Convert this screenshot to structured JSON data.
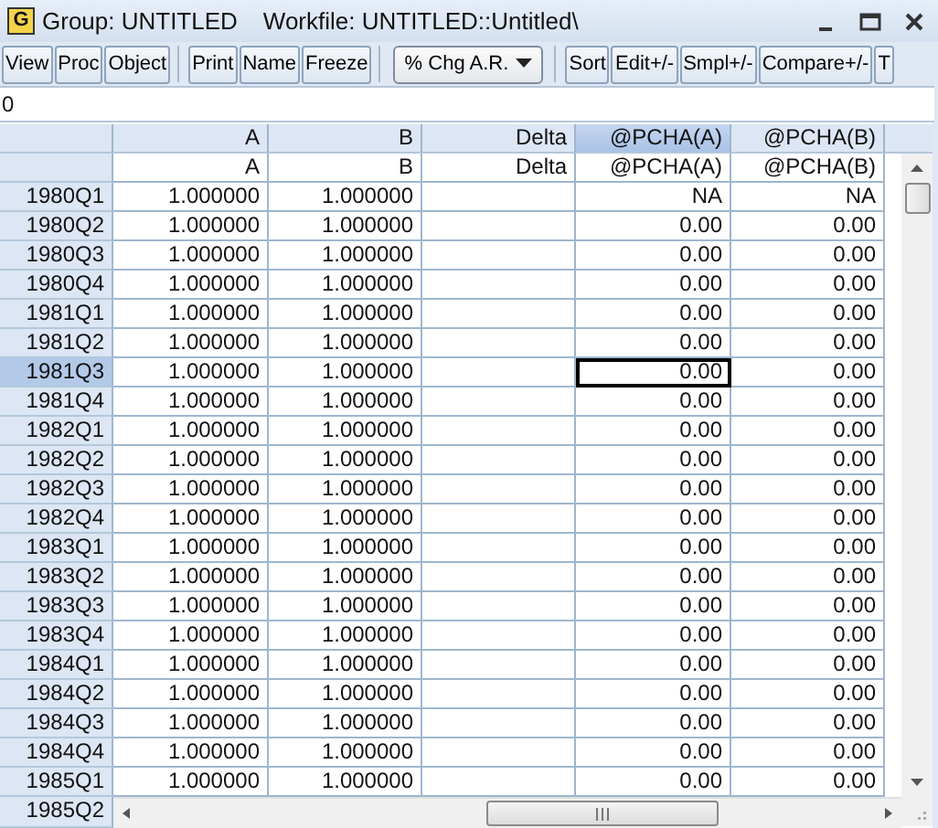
{
  "window": {
    "icon_letter": "G",
    "title": "Group: UNTITLED",
    "workfile": "Workfile: UNTITLED::Untitled\\"
  },
  "toolbar": [
    {
      "kind": "button",
      "label": "View"
    },
    {
      "kind": "button",
      "label": "Proc"
    },
    {
      "kind": "button",
      "label": "Object"
    },
    {
      "kind": "separator"
    },
    {
      "kind": "button",
      "label": "Print"
    },
    {
      "kind": "button",
      "label": "Name"
    },
    {
      "kind": "button",
      "label": "Freeze"
    },
    {
      "kind": "separator"
    },
    {
      "kind": "dropdown",
      "label": "% Chg A.R."
    },
    {
      "kind": "separator"
    },
    {
      "kind": "button",
      "label": "Sort"
    },
    {
      "kind": "button",
      "label": "Edit+/-"
    },
    {
      "kind": "button",
      "label": "Smpl+/-"
    },
    {
      "kind": "button",
      "label": "Compare+/-"
    },
    {
      "kind": "button",
      "label": "T"
    }
  ],
  "edit_line": "0",
  "columns": [
    {
      "header": "A",
      "name": "A",
      "selected": false
    },
    {
      "header": "B",
      "name": "B",
      "selected": false
    },
    {
      "header": "Delta",
      "name": "Delta",
      "selected": false
    },
    {
      "header": "@PCHA(A)",
      "name": "@PCHA(A)",
      "selected": true
    },
    {
      "header": "@PCHA(B)",
      "name": "@PCHA(B)",
      "selected": false
    }
  ],
  "rows": [
    {
      "label": "1980Q1",
      "selected": false,
      "cells": [
        {
          "text": "1.000000",
          "selected": false
        },
        {
          "text": "1.000000",
          "selected": false
        },
        {
          "text": "",
          "selected": false
        },
        {
          "text": "NA",
          "selected": false
        },
        {
          "text": "NA",
          "selected": false
        }
      ]
    },
    {
      "label": "1980Q2",
      "selected": false,
      "cells": [
        {
          "text": "1.000000",
          "selected": false
        },
        {
          "text": "1.000000",
          "selected": false
        },
        {
          "text": "",
          "selected": false
        },
        {
          "text": "0.00",
          "selected": false
        },
        {
          "text": "0.00",
          "selected": false
        }
      ]
    },
    {
      "label": "1980Q3",
      "selected": false,
      "cells": [
        {
          "text": "1.000000",
          "selected": false
        },
        {
          "text": "1.000000",
          "selected": false
        },
        {
          "text": "",
          "selected": false
        },
        {
          "text": "0.00",
          "selected": false
        },
        {
          "text": "0.00",
          "selected": false
        }
      ]
    },
    {
      "label": "1980Q4",
      "selected": false,
      "cells": [
        {
          "text": "1.000000",
          "selected": false
        },
        {
          "text": "1.000000",
          "selected": false
        },
        {
          "text": "",
          "selected": false
        },
        {
          "text": "0.00",
          "selected": false
        },
        {
          "text": "0.00",
          "selected": false
        }
      ]
    },
    {
      "label": "1981Q1",
      "selected": false,
      "cells": [
        {
          "text": "1.000000",
          "selected": false
        },
        {
          "text": "1.000000",
          "selected": false
        },
        {
          "text": "",
          "selected": false
        },
        {
          "text": "0.00",
          "selected": false
        },
        {
          "text": "0.00",
          "selected": false
        }
      ]
    },
    {
      "label": "1981Q2",
      "selected": false,
      "cells": [
        {
          "text": "1.000000",
          "selected": false
        },
        {
          "text": "1.000000",
          "selected": false
        },
        {
          "text": "",
          "selected": false
        },
        {
          "text": "0.00",
          "selected": false
        },
        {
          "text": "0.00",
          "selected": false
        }
      ]
    },
    {
      "label": "1981Q3",
      "selected": true,
      "cells": [
        {
          "text": "1.000000",
          "selected": false
        },
        {
          "text": "1.000000",
          "selected": false
        },
        {
          "text": "",
          "selected": false
        },
        {
          "text": "0.00",
          "selected": true
        },
        {
          "text": "0.00",
          "selected": false
        }
      ]
    },
    {
      "label": "1981Q4",
      "selected": false,
      "cells": [
        {
          "text": "1.000000",
          "selected": false
        },
        {
          "text": "1.000000",
          "selected": false
        },
        {
          "text": "",
          "selected": false
        },
        {
          "text": "0.00",
          "selected": false
        },
        {
          "text": "0.00",
          "selected": false
        }
      ]
    },
    {
      "label": "1982Q1",
      "selected": false,
      "cells": [
        {
          "text": "1.000000",
          "selected": false
        },
        {
          "text": "1.000000",
          "selected": false
        },
        {
          "text": "",
          "selected": false
        },
        {
          "text": "0.00",
          "selected": false
        },
        {
          "text": "0.00",
          "selected": false
        }
      ]
    },
    {
      "label": "1982Q2",
      "selected": false,
      "cells": [
        {
          "text": "1.000000",
          "selected": false
        },
        {
          "text": "1.000000",
          "selected": false
        },
        {
          "text": "",
          "selected": false
        },
        {
          "text": "0.00",
          "selected": false
        },
        {
          "text": "0.00",
          "selected": false
        }
      ]
    },
    {
      "label": "1982Q3",
      "selected": false,
      "cells": [
        {
          "text": "1.000000",
          "selected": false
        },
        {
          "text": "1.000000",
          "selected": false
        },
        {
          "text": "",
          "selected": false
        },
        {
          "text": "0.00",
          "selected": false
        },
        {
          "text": "0.00",
          "selected": false
        }
      ]
    },
    {
      "label": "1982Q4",
      "selected": false,
      "cells": [
        {
          "text": "1.000000",
          "selected": false
        },
        {
          "text": "1.000000",
          "selected": false
        },
        {
          "text": "",
          "selected": false
        },
        {
          "text": "0.00",
          "selected": false
        },
        {
          "text": "0.00",
          "selected": false
        }
      ]
    },
    {
      "label": "1983Q1",
      "selected": false,
      "cells": [
        {
          "text": "1.000000",
          "selected": false
        },
        {
          "text": "1.000000",
          "selected": false
        },
        {
          "text": "",
          "selected": false
        },
        {
          "text": "0.00",
          "selected": false
        },
        {
          "text": "0.00",
          "selected": false
        }
      ]
    },
    {
      "label": "1983Q2",
      "selected": false,
      "cells": [
        {
          "text": "1.000000",
          "selected": false
        },
        {
          "text": "1.000000",
          "selected": false
        },
        {
          "text": "",
          "selected": false
        },
        {
          "text": "0.00",
          "selected": false
        },
        {
          "text": "0.00",
          "selected": false
        }
      ]
    },
    {
      "label": "1983Q3",
      "selected": false,
      "cells": [
        {
          "text": "1.000000",
          "selected": false
        },
        {
          "text": "1.000000",
          "selected": false
        },
        {
          "text": "",
          "selected": false
        },
        {
          "text": "0.00",
          "selected": false
        },
        {
          "text": "0.00",
          "selected": false
        }
      ]
    },
    {
      "label": "1983Q4",
      "selected": false,
      "cells": [
        {
          "text": "1.000000",
          "selected": false
        },
        {
          "text": "1.000000",
          "selected": false
        },
        {
          "text": "",
          "selected": false
        },
        {
          "text": "0.00",
          "selected": false
        },
        {
          "text": "0.00",
          "selected": false
        }
      ]
    },
    {
      "label": "1984Q1",
      "selected": false,
      "cells": [
        {
          "text": "1.000000",
          "selected": false
        },
        {
          "text": "1.000000",
          "selected": false
        },
        {
          "text": "",
          "selected": false
        },
        {
          "text": "0.00",
          "selected": false
        },
        {
          "text": "0.00",
          "selected": false
        }
      ]
    },
    {
      "label": "1984Q2",
      "selected": false,
      "cells": [
        {
          "text": "1.000000",
          "selected": false
        },
        {
          "text": "1.000000",
          "selected": false
        },
        {
          "text": "",
          "selected": false
        },
        {
          "text": "0.00",
          "selected": false
        },
        {
          "text": "0.00",
          "selected": false
        }
      ]
    },
    {
      "label": "1984Q3",
      "selected": false,
      "cells": [
        {
          "text": "1.000000",
          "selected": false
        },
        {
          "text": "1.000000",
          "selected": false
        },
        {
          "text": "",
          "selected": false
        },
        {
          "text": "0.00",
          "selected": false
        },
        {
          "text": "0.00",
          "selected": false
        }
      ]
    },
    {
      "label": "1984Q4",
      "selected": false,
      "cells": [
        {
          "text": "1.000000",
          "selected": false
        },
        {
          "text": "1.000000",
          "selected": false
        },
        {
          "text": "",
          "selected": false
        },
        {
          "text": "0.00",
          "selected": false
        },
        {
          "text": "0.00",
          "selected": false
        }
      ]
    },
    {
      "label": "1985Q1",
      "selected": false,
      "cells": [
        {
          "text": "1.000000",
          "selected": false
        },
        {
          "text": "1.000000",
          "selected": false
        },
        {
          "text": "",
          "selected": false
        },
        {
          "text": "0.00",
          "selected": false
        },
        {
          "text": "0.00",
          "selected": false
        }
      ]
    }
  ],
  "partial_row": {
    "label": "1985Q2"
  }
}
